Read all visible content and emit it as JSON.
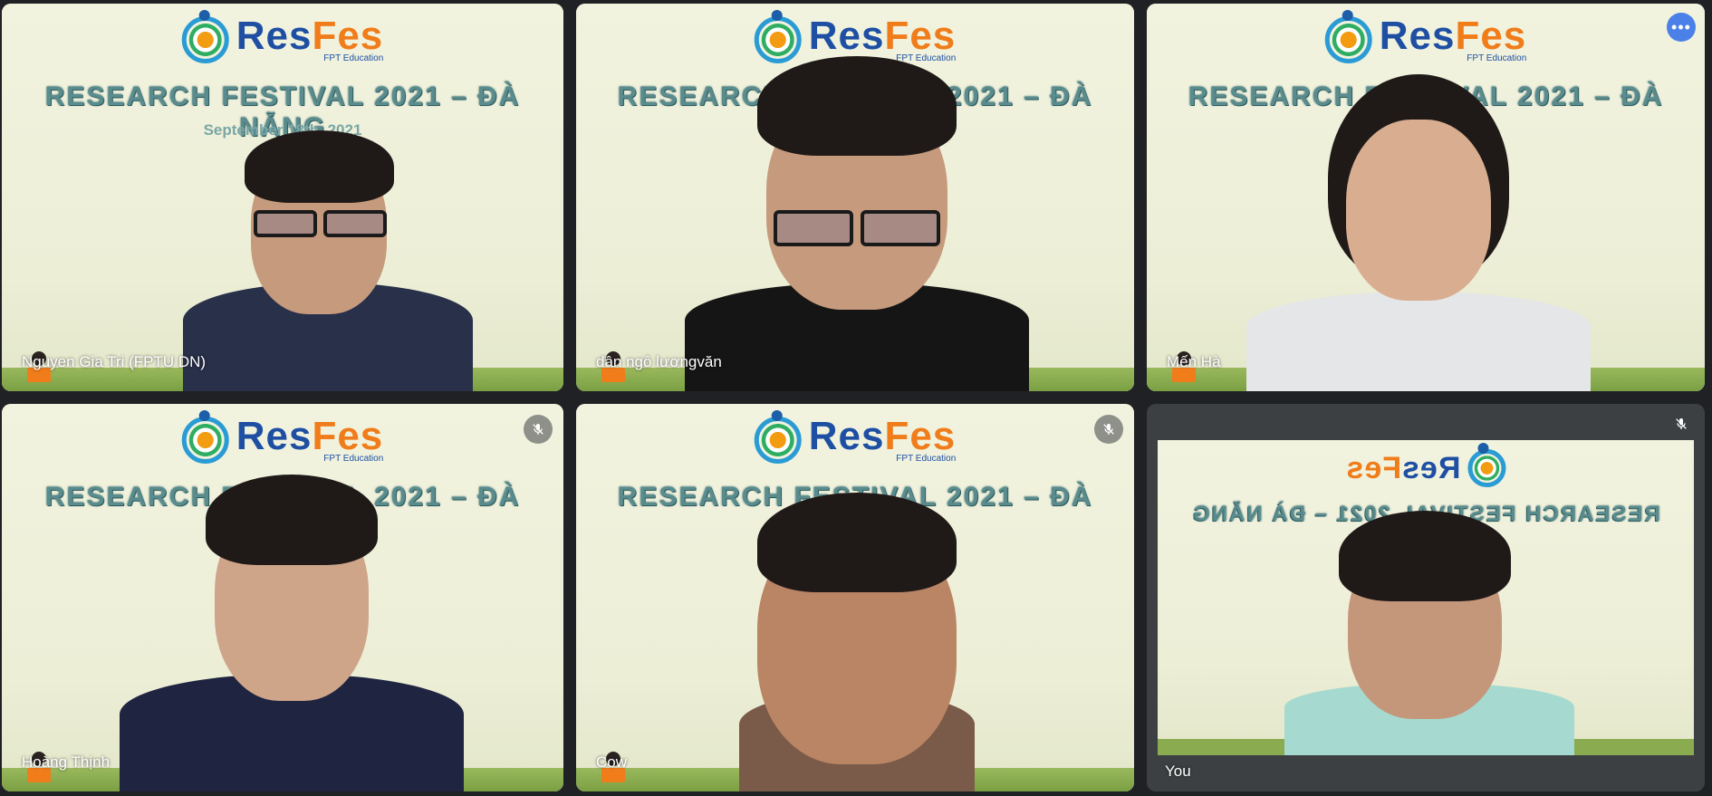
{
  "participants": [
    {
      "name": "Nguyen Gia Tri (FPTU DN)",
      "muted": false,
      "active": false
    },
    {
      "name": "dân ngô lươngvăn",
      "muted": false,
      "active": false
    },
    {
      "name": "Mến Hà",
      "muted": false,
      "active": true
    },
    {
      "name": "Hoàng Thịnh",
      "muted": true,
      "active": false
    },
    {
      "name": "Cow",
      "muted": true,
      "active": false
    },
    {
      "name": "You",
      "muted": true,
      "active": false,
      "self": true
    }
  ],
  "background": {
    "logo_res": "Res",
    "logo_fes": "Fes",
    "logo_sub": "FPT Education",
    "banner": "RESEARCH FESTIVAL 2021 – ĐÀ NẴNG",
    "date": "September 18th, 2021"
  },
  "icons": {
    "mute": "mic-off-icon",
    "more": "more-options-icon"
  },
  "colors": {
    "active_border": "#5b8def",
    "tile_bg": "#202124",
    "logo_blue": "#1e4fa3",
    "logo_orange": "#f07c1a"
  }
}
